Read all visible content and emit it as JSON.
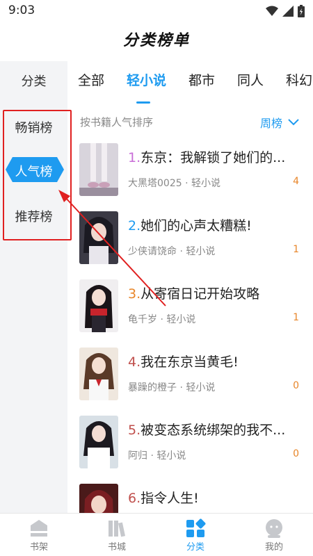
{
  "status_bar": {
    "time": "9:03"
  },
  "header": {
    "title": "分类榜单"
  },
  "sidebar": {
    "header": "分类",
    "items": [
      {
        "label": "畅销榜",
        "active": false
      },
      {
        "label": "人气榜",
        "active": true
      },
      {
        "label": "推荐榜",
        "active": false
      }
    ]
  },
  "tabs": [
    {
      "label": "全部"
    },
    {
      "label": "轻小说",
      "active": true
    },
    {
      "label": "都市"
    },
    {
      "label": "同人"
    },
    {
      "label": "科幻"
    }
  ],
  "list_header": {
    "sort_label": "按书籍人气排序",
    "period": "周榜"
  },
  "books": [
    {
      "rank": "1.",
      "title": "东京：我解锁了她们的...",
      "author": "大黑塔0025",
      "category": "轻小说",
      "count": "4",
      "rank_color": "#c86dd7"
    },
    {
      "rank": "2.",
      "title": "她们的心声太糟糕!",
      "author": "少侠请饶命",
      "category": "轻小说",
      "count": "1",
      "rank_color": "#1e9bf0"
    },
    {
      "rank": "3.",
      "title": "从寄宿日记开始攻略",
      "author": "龟千岁",
      "category": "轻小说",
      "count": "1",
      "rank_color": "#e8862a"
    },
    {
      "rank": "4.",
      "title": "我在东京当黄毛!",
      "author": "暴躁的橙子",
      "category": "轻小说",
      "count": "0",
      "rank_color": "#c0504d"
    },
    {
      "rank": "5.",
      "title": "被变态系统绑架的我不...",
      "author": "阿归",
      "category": "轻小说",
      "count": "0",
      "rank_color": "#c0504d"
    },
    {
      "rank": "6.",
      "title": "指令人生!",
      "author": "",
      "category": "",
      "count": "",
      "rank_color": "#c0504d"
    }
  ],
  "bottom_nav": [
    {
      "label": "书架",
      "icon": "bookshelf-icon"
    },
    {
      "label": "书城",
      "icon": "bookstore-icon"
    },
    {
      "label": "分类",
      "icon": "category-icon",
      "active": true
    },
    {
      "label": "我的",
      "icon": "profile-icon"
    }
  ],
  "colors": {
    "accent": "#1e9bf0",
    "annotation": "#e02020",
    "count": "#e8862a"
  }
}
